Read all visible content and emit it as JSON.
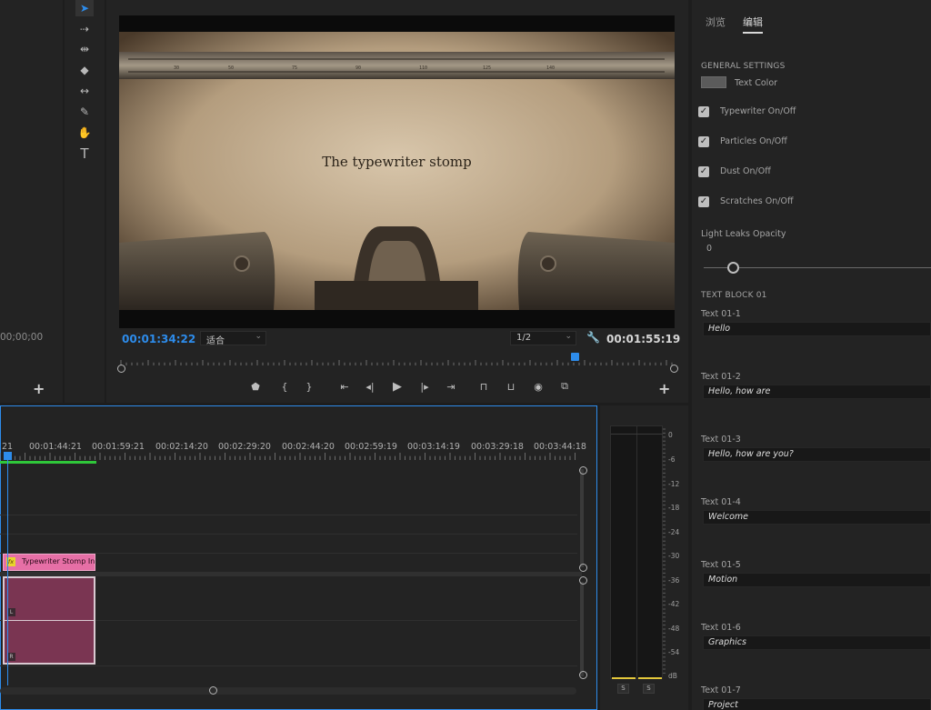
{
  "project": {
    "timecode": "00;00;00",
    "add_label": "+"
  },
  "tools": [
    {
      "name": "selection-tool",
      "glyph": "➤"
    },
    {
      "name": "track-select-tool",
      "glyph": "⇢"
    },
    {
      "name": "ripple-edit-tool",
      "glyph": "⇹"
    },
    {
      "name": "razor-tool",
      "glyph": "◆"
    },
    {
      "name": "slip-tool",
      "glyph": "↔"
    },
    {
      "name": "pen-tool",
      "glyph": "✎"
    },
    {
      "name": "hand-tool",
      "glyph": "✋"
    },
    {
      "name": "type-tool",
      "glyph": "T"
    }
  ],
  "monitor": {
    "video_text": "The typewriter stomp",
    "current_time": "00:01:34:22",
    "fit_select": "适合",
    "resolution_select": "1/2",
    "duration": "00:01:55:19",
    "playhead_fraction": 0.82,
    "add_label": "+"
  },
  "timeline": {
    "ruler_labels": [
      "21",
      "00:01:44:21",
      "00:01:59:21",
      "00:02:14:20",
      "00:02:29:20",
      "00:02:44:20",
      "00:02:59:19",
      "00:03:14:19",
      "00:03:29:18",
      "00:03:44:18"
    ],
    "clip_label": "Typewriter Stomp Intr",
    "fx_badge": "fx",
    "audio_channels": [
      "L",
      "R"
    ]
  },
  "meters": {
    "scale": [
      "0",
      "-6",
      "-12",
      "-18",
      "-24",
      "-30",
      "-36",
      "-42",
      "-48",
      "-54",
      "dB"
    ],
    "solo_labels": [
      "S",
      "S"
    ]
  },
  "egp": {
    "tabs": [
      "浏览",
      "编辑"
    ],
    "active_tab": 1,
    "general_title": "GENERAL SETTINGS",
    "text_color_label": "Text Color",
    "text_color_swatch": "#5b5b5b",
    "checkboxes": [
      {
        "label": "Typewriter On/Off",
        "checked": true
      },
      {
        "label": "Particles On/Off",
        "checked": true
      },
      {
        "label": "Dust On/Off",
        "checked": true
      },
      {
        "label": "Scratches On/Off",
        "checked": true
      }
    ],
    "light_leaks_label": "Light Leaks Opacity",
    "light_leaks_value": "0",
    "text_block_title": "TEXT BLOCK 01",
    "fields": [
      {
        "label": "Text 01-1",
        "value": "Hello"
      },
      {
        "label": "Text 01-2",
        "value": "Hello, how are"
      },
      {
        "label": "Text 01-3",
        "value": "Hello, how are you?"
      },
      {
        "label": "Text 01-4",
        "value": "Welcome"
      },
      {
        "label": "Text 01-5",
        "value": "Motion"
      },
      {
        "label": "Text 01-6",
        "value": "Graphics"
      },
      {
        "label": "Text 01-7",
        "value": "Project"
      }
    ]
  },
  "colors": {
    "accent": "#2d8ceb",
    "clip_video": "#e66fa6",
    "clip_audio": "#7a3552",
    "meter_level": "#e3c73a"
  }
}
